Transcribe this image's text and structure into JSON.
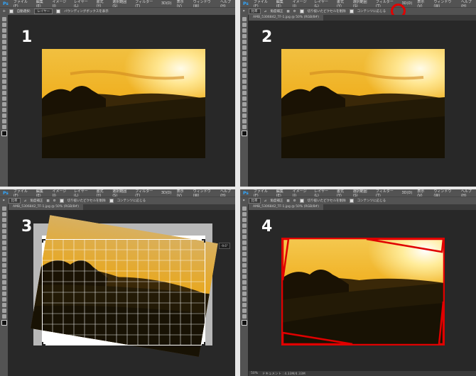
{
  "menu": {
    "logo": "Ps",
    "items": [
      "ファイル(F)",
      "編集(E)",
      "イメージ(I)",
      "レイヤー(L)",
      "書式(Y)",
      "選択範囲(S)",
      "フィルター(T)",
      "3D(D)",
      "表示(V)",
      "ウィンドウ(W)",
      "ヘルプ(H)"
    ]
  },
  "options_move": {
    "auto_select": "自動選択:",
    "layer": "レイヤー",
    "transform": "バウンディングボックスを表示"
  },
  "options_crop": {
    "ratio": "比率",
    "straighten": "角度補正",
    "delete_pixels": "切り抜いたピクセルを削除",
    "content_aware": "コンテンツに応じる"
  },
  "tooltip": "切り抜き範囲の外側の領域をコンテンツに応じて塗りつぶします",
  "document_tab": "AMB_5306842_TF-1.jpg @ 50% (RGB/8#)",
  "status": {
    "zoom": "50%",
    "doc": "ドキュメント : 4.33M/4.33M"
  },
  "angle_label": "-9.6°",
  "steps": [
    "1",
    "2",
    "3",
    "4"
  ],
  "colors": {
    "panel_bg": "#282828",
    "chrome": "#535353",
    "highlight_red": "#e00000"
  }
}
